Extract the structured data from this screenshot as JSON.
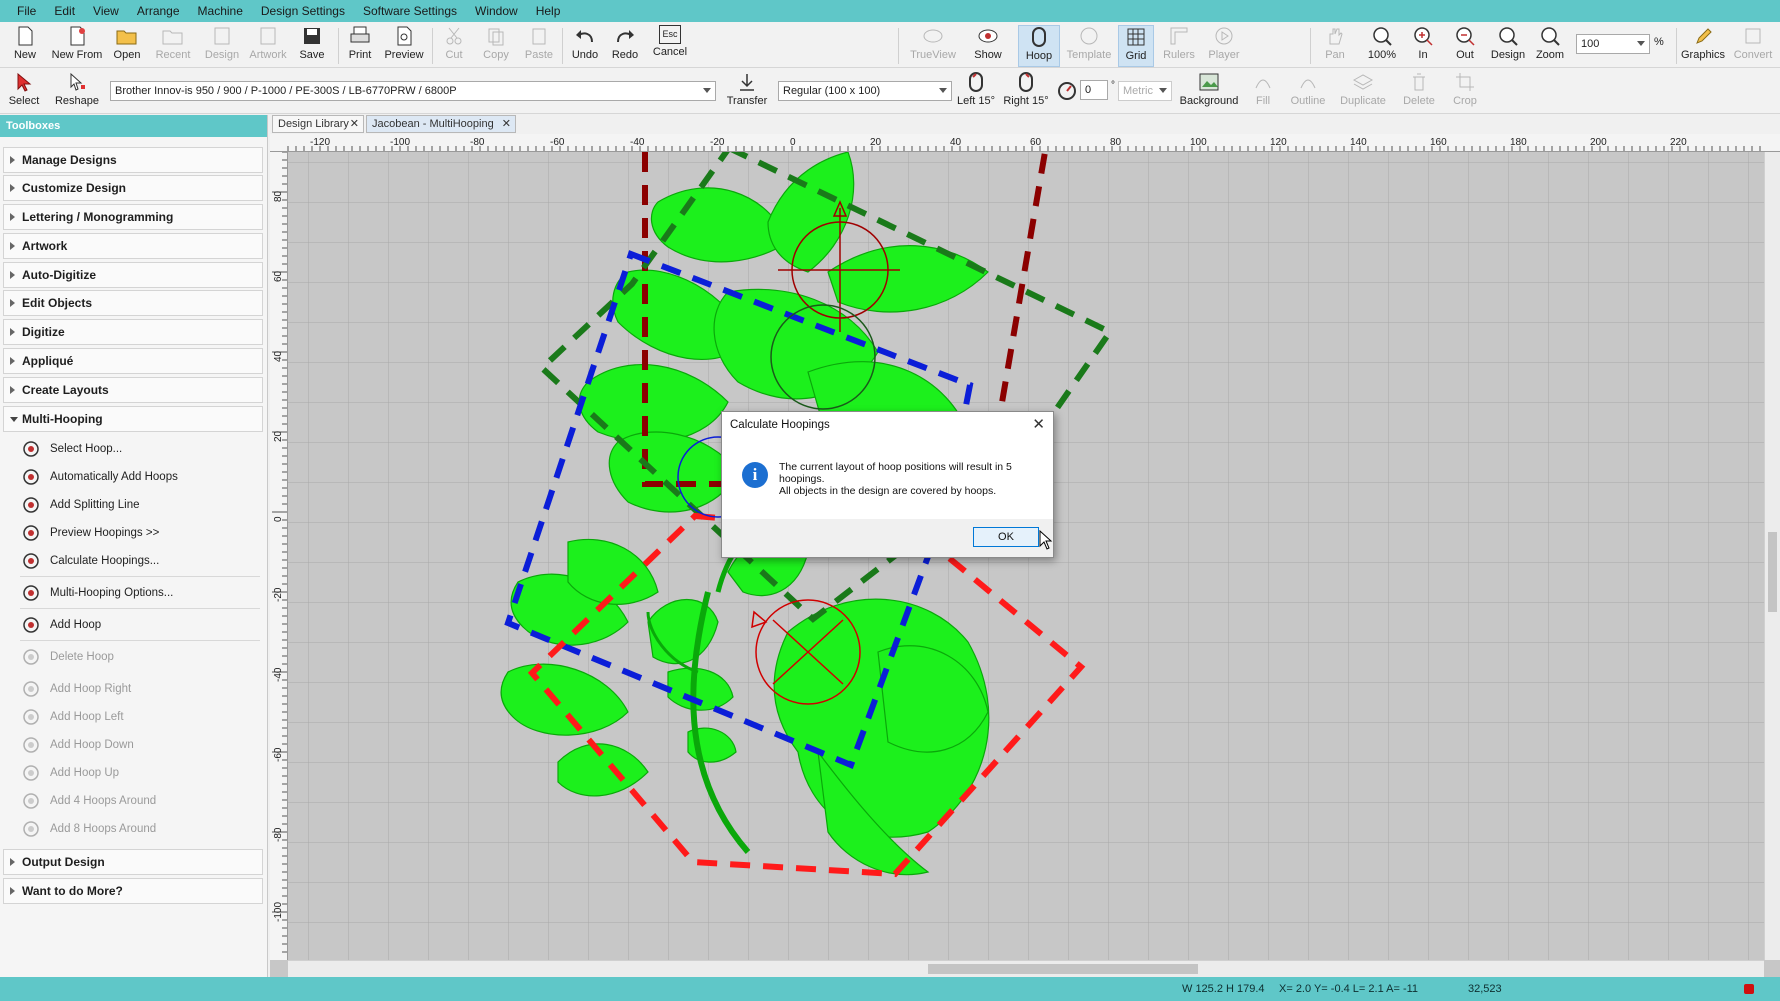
{
  "menu": [
    "File",
    "Edit",
    "View",
    "Arrange",
    "Machine",
    "Design Settings",
    "Software Settings",
    "Window",
    "Help"
  ],
  "toolbar1": {
    "new": "New",
    "new_from": "New From",
    "open": "Open",
    "recent": "Recent",
    "design": "Design",
    "artwork": "Artwork",
    "save": "Save",
    "print": "Print",
    "preview": "Preview",
    "cut": "Cut",
    "copy": "Copy",
    "paste": "Paste",
    "undo": "Undo",
    "redo": "Redo",
    "cancel": "Cancel",
    "cancel_key": "Esc",
    "trueview": "TrueView",
    "show": "Show",
    "hoop": "Hoop",
    "template": "Template",
    "grid": "Grid",
    "rulers": "Rulers",
    "player": "Player",
    "pan": "Pan",
    "zoom100": "100%",
    "zoom_in": "In",
    "zoom_out": "Out",
    "zoom_design": "Design",
    "zoom": "Zoom",
    "zoom_value": "100",
    "zoom_unit": "%",
    "graphics": "Graphics",
    "convert": "Convert"
  },
  "toolbar2": {
    "select": "Select",
    "reshape": "Reshape",
    "machine": "Brother Innov-is 950 / 900 / P-1000 / PE-300S / LB-6770PRW / 6800P",
    "transfer": "Transfer",
    "hoop_size": "Regular (100 x 100)",
    "left15": "Left 15°",
    "right15": "Right 15°",
    "angle": "0",
    "degree_sign": "°",
    "units": "Metric",
    "background": "Background",
    "fill": "Fill",
    "outline": "Outline",
    "duplicate": "Duplicate",
    "delete": "Delete",
    "crop": "Crop"
  },
  "toolboxes": {
    "header": "Toolboxes",
    "sections": [
      "Manage Designs",
      "Customize Design",
      "Lettering / Monogramming",
      "Artwork",
      "Auto-Digitize",
      "Edit Objects",
      "Digitize",
      "Appliqué",
      "Create Layouts",
      "Multi-Hooping"
    ],
    "multihooping_items": [
      "Select Hoop...",
      "Automatically Add Hoops",
      "Add Splitting Line",
      "Preview Hoopings >>",
      "Calculate Hoopings...",
      "Multi-Hooping Options...",
      "Add Hoop",
      "Delete Hoop",
      "Add Hoop Right",
      "Add Hoop Left",
      "Add Hoop Down",
      "Add Hoop Up",
      "Add 4 Hoops Around",
      "Add 8 Hoops Around"
    ],
    "bottom_sections": [
      "Output Design",
      "Want to do More?"
    ]
  },
  "tabs": [
    "Design Library",
    "Jacobean - MultiHooping"
  ],
  "ruler_top": [
    "-120",
    "-100",
    "-80",
    "-60",
    "-40",
    "-20",
    "0",
    "20",
    "40",
    "60",
    "80",
    "100",
    "120",
    "140",
    "160",
    "180",
    "200",
    "220"
  ],
  "ruler_left": [
    "80",
    "60",
    "40",
    "20",
    "0",
    "-20",
    "-40",
    "-60",
    "-80",
    "-100"
  ],
  "dialog": {
    "title": "Calculate Hoopings",
    "line1": "The current layout of hoop positions will result in 5",
    "line2": "hoopings.",
    "line3": "All objects in the design are covered by hoops.",
    "ok": "OK",
    "icon": "info-icon",
    "icon_glyph": "i",
    "close_glyph": "✕"
  },
  "status": {
    "size": "W 125.2 H 179.4",
    "coords": "X= 2.0 Y= -0.4 L= 2.1 A= -11",
    "stitches": "32,523"
  },
  "colors": {
    "accent": "#5fc7c8",
    "stitch_green": "#00e000",
    "hoop_dark_red": "#8b0000",
    "hoop_green": "#1a7a1a",
    "hoop_blue": "#0b1ed8",
    "hoop_red": "#ff1a1a"
  }
}
